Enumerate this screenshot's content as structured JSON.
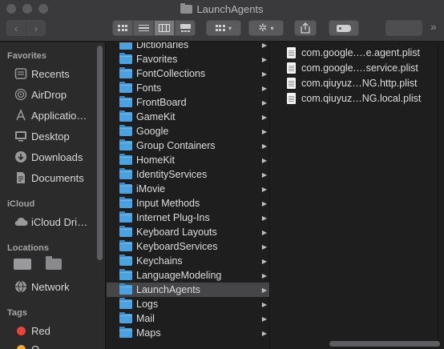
{
  "window": {
    "title": "LaunchAgents"
  },
  "sidebar": {
    "sections": [
      {
        "heading": "Favorites",
        "items": [
          {
            "label": "Recents",
            "icon": "clock-icon"
          },
          {
            "label": "AirDrop",
            "icon": "airdrop-icon"
          },
          {
            "label": "Applicatio…",
            "icon": "applications-icon"
          },
          {
            "label": "Desktop",
            "icon": "desktop-icon"
          },
          {
            "label": "Downloads",
            "icon": "download-icon"
          },
          {
            "label": "Documents",
            "icon": "document-icon"
          }
        ]
      },
      {
        "heading": "iCloud",
        "items": [
          {
            "label": "iCloud Dri…",
            "icon": "cloud-icon"
          }
        ]
      },
      {
        "heading": "Locations",
        "items": [
          {
            "label": "Network",
            "icon": "globe-icon"
          }
        ]
      },
      {
        "heading": "Tags",
        "items": [
          {
            "label": "Red",
            "color": "#e8443a"
          },
          {
            "label": "O",
            "color": "#f5a623"
          }
        ]
      }
    ]
  },
  "column1": {
    "folders": [
      "Dictionaries",
      "Favorites",
      "FontCollections",
      "Fonts",
      "FrontBoard",
      "GameKit",
      "Google",
      "Group Containers",
      "HomeKit",
      "IdentityServices",
      "iMovie",
      "Input Methods",
      "Internet Plug-Ins",
      "Keyboard Layouts",
      "KeyboardServices",
      "Keychains",
      "LanguageModeling",
      "LaunchAgents",
      "Logs",
      "Mail",
      "Maps"
    ],
    "selected": "LaunchAgents"
  },
  "column2": {
    "files": [
      "com.google.…e.agent.plist",
      "com.google.…service.plist",
      "com.qiuyuz…NG.http.plist",
      "com.qiuyuz…NG.local.plist"
    ]
  },
  "colors": {
    "folder_blue": "#4aa3e0",
    "selection": "#464648",
    "sidebar_bg": "#2c2b2c"
  }
}
